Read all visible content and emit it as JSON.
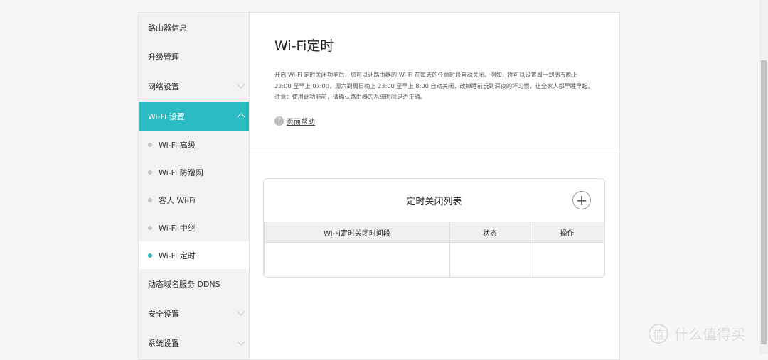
{
  "sidebar": {
    "items": [
      "路由器信息",
      "升级管理",
      "网络设置",
      "Wi-Fi 设置"
    ],
    "sub": [
      "Wi-Fi 高级",
      "Wi-Fi 防蹭网",
      "客人 Wi-Fi",
      "Wi-Fi 中继",
      "Wi-Fi 定时"
    ],
    "after": [
      "动态域名服务 DDNS",
      "安全设置",
      "系统设置"
    ]
  },
  "main": {
    "title": "Wi-Fi定时",
    "desc": "开启 Wi-Fi 定时关闭功能后，您可以让路由器的 Wi-Fi 在每天的任意时段自动关闭。例如，你可以设置周一到周五晚上 22:00 至早上 07:00，周六到周日晚上 23:00 至早上 8:00 自动关闭，改掉睡前玩到深夜的坏习惯，让全家人都早睡早起。",
    "note": "注意：使用此功能前，请确认路由器的系统时间是否正确。",
    "help": "页面帮助",
    "list_title": "定时关闭列表",
    "add": "+",
    "columns": [
      "Wi-Fi定时关闭时间段",
      "状态",
      "操作"
    ]
  },
  "watermark": {
    "logo": "值",
    "text": "什么值得买"
  }
}
